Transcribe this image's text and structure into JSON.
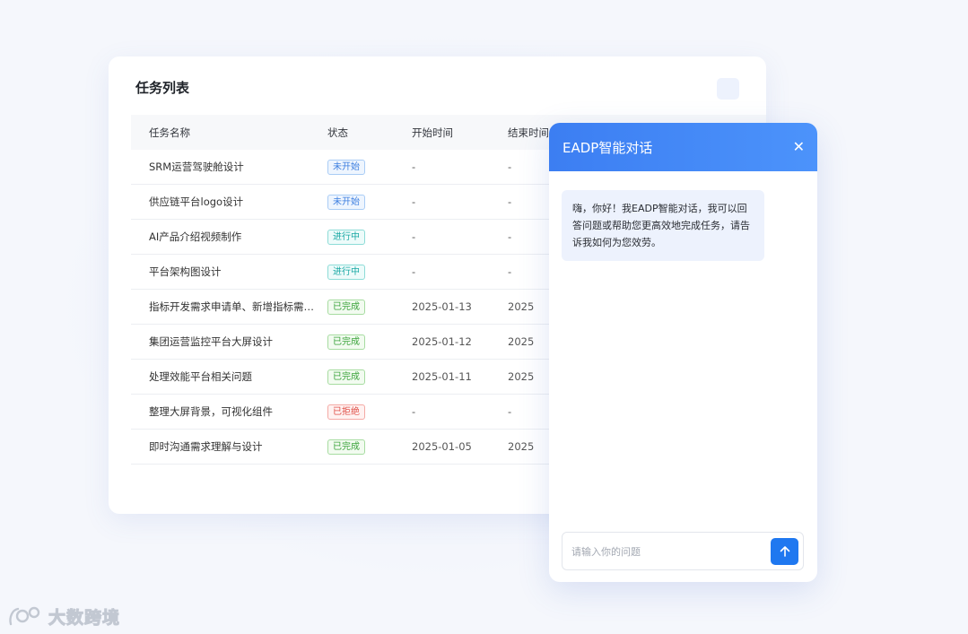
{
  "task_list": {
    "title": "任务列表",
    "columns": {
      "name": "任务名称",
      "status": "状态",
      "start": "开始时间",
      "end": "结束时间"
    },
    "rows": [
      {
        "name": "SRM运营驾驶舱设计",
        "status": "未开始",
        "status_type": "not-started",
        "start": "-",
        "end": "-"
      },
      {
        "name": "供应链平台logo设计",
        "status": "未开始",
        "status_type": "not-started",
        "start": "-",
        "end": "-"
      },
      {
        "name": "AI产品介绍视频制作",
        "status": "进行中",
        "status_type": "in-progress",
        "start": "-",
        "end": "-"
      },
      {
        "name": "平台架构图设计",
        "status": "进行中",
        "status_type": "in-progress",
        "start": "-",
        "end": "-"
      },
      {
        "name": "指标开发需求申请单、新增指标需…",
        "status": "已完成",
        "status_type": "done",
        "start": "2025-01-13",
        "end": "2025"
      },
      {
        "name": "集团运营监控平台大屏设计",
        "status": "已完成",
        "status_type": "done",
        "start": "2025-01-12",
        "end": "2025"
      },
      {
        "name": "处理效能平台相关问题",
        "status": "已完成",
        "status_type": "done",
        "start": "2025-01-11",
        "end": "2025"
      },
      {
        "name": "整理大屏背景，可视化组件",
        "status": "已拒绝",
        "status_type": "rejected",
        "start": "-",
        "end": "-"
      },
      {
        "name": "即时沟通需求理解与设计",
        "status": "已完成",
        "status_type": "done",
        "start": "2025-01-05",
        "end": "2025"
      }
    ]
  },
  "chat": {
    "title": "EADP智能对话",
    "close_icon": "close-icon",
    "message": "嗨，你好！我EADP智能对话，我可以回答问题或帮助您更高效地完成任务，请告诉我如何为您效劳。",
    "input_placeholder": "请输入你的问题",
    "send_icon": "arrow-up-icon"
  },
  "watermark": {
    "text": "大数跨境"
  },
  "colors": {
    "accent": "#3c7ef2",
    "send": "#1f78f0"
  }
}
